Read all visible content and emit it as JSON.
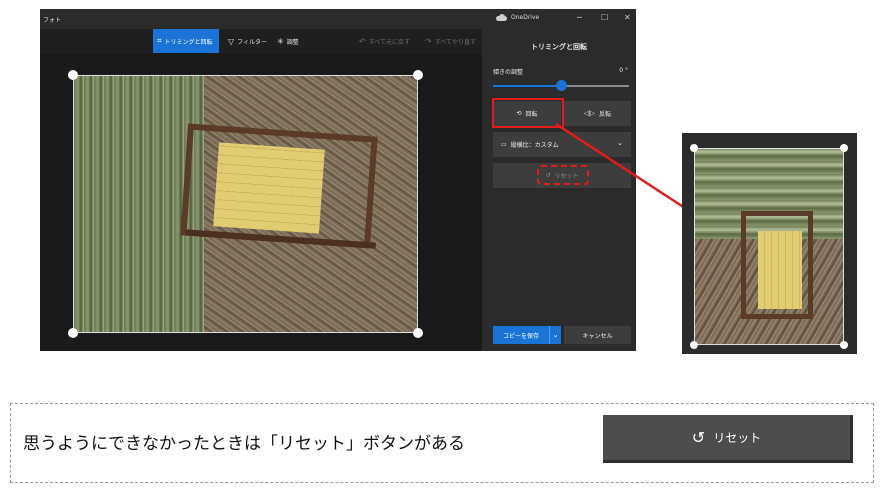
{
  "window": {
    "app_title": "フォト",
    "onedrive_label": "OneDrive",
    "minimize": "─",
    "maximize": "☐",
    "close": "✕"
  },
  "toolbar": {
    "crop_rotate_label": "トリミングと回転",
    "filter_label": "フィルター",
    "adjust_label": "調整",
    "undo_all_label": "すべて元に戻す",
    "redo_all_label": "すべてやり直す"
  },
  "panel": {
    "title": "トリミングと回転",
    "straighten_label": "傾きの調整",
    "straighten_value": "0 °",
    "straighten_level": 0.5,
    "rotate_label": "回転",
    "flip_label": "反転",
    "aspect_label": "縦横比：カスタム",
    "reset_label": "リセット",
    "save_copy_label": "コピーを保存",
    "cancel_label": "キャンセル"
  },
  "caption": {
    "text": "思うようにできなかったときは「リセット」ボタンがある",
    "reset_button_label": "リセット"
  },
  "colors": {
    "accent": "#1a73d6",
    "highlight": "#e21b1b"
  }
}
